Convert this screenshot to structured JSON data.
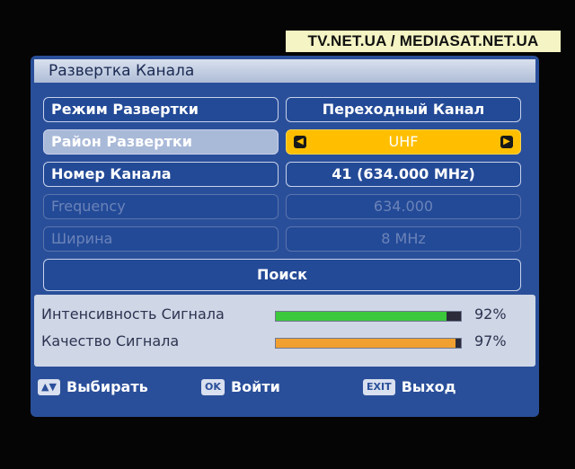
{
  "watermark": "TV.NET.UA / MEDIASAT.NET.UA",
  "window": {
    "title": "Развертка Канала"
  },
  "settings": [
    {
      "label": "Режим Развертки",
      "value": "Переходный Канал",
      "state": "normal"
    },
    {
      "label": "Район Развертки",
      "value": "UHF",
      "state": "selected"
    },
    {
      "label": "Номер Канала",
      "value": "41 (634.000 MHz)",
      "state": "normal"
    },
    {
      "label": "Frequency",
      "value": "634.000",
      "state": "disabled"
    },
    {
      "label": "Ширина",
      "value": "8 MHz",
      "state": "disabled"
    }
  ],
  "search_button": "Поиск",
  "signal": {
    "strength": {
      "label": "Интенсивность Сигнала",
      "value_text": "92%",
      "level": 0.92,
      "color": "#3cc83c"
    },
    "quality": {
      "label": "Качество Сигнала",
      "value_text": "97%",
      "level": 0.97,
      "color": "#f0a030"
    }
  },
  "footer": {
    "select": {
      "key_icon": "up-down-arrows-icon",
      "text": "Выбирать"
    },
    "ok": {
      "key": "OK",
      "text": "Войти"
    },
    "exit": {
      "key": "EXIT",
      "text": "Выход"
    }
  },
  "colors": {
    "background": "#2a4f9a",
    "highlight": "#ffbf00"
  }
}
